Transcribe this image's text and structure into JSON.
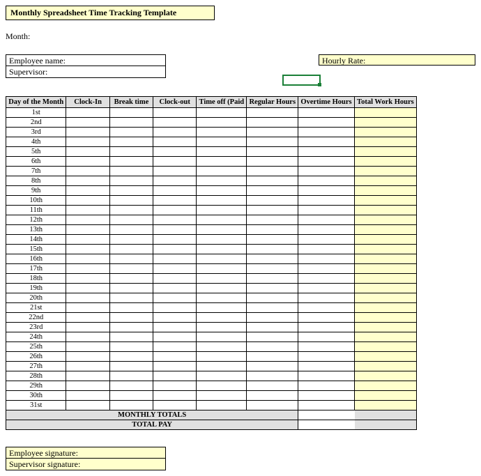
{
  "title": "Monthly Spreadsheet Time Tracking Template",
  "month_label": "Month:",
  "employee_name_label": "Employee name:",
  "supervisor_label": "Supervisor:",
  "hourly_rate_label": "Hourly Rate:",
  "columns": [
    "Day of the Month",
    "Clock-In",
    "Break time",
    "Clock-out",
    "Time off (Paid",
    "Regular Hours",
    "Overtime Hours",
    "Total Work Hours"
  ],
  "days": [
    "1st",
    "2nd",
    "3rd",
    "4th",
    "5th",
    "6th",
    "7th",
    "8th",
    "9th",
    "10th",
    "11th",
    "12th",
    "13th",
    "14th",
    "15th",
    "16th",
    "17th",
    "18th",
    "19th",
    "20th",
    "21st",
    "22nd",
    "23rd",
    "24th",
    "25th",
    "26th",
    "27th",
    "28th",
    "29th",
    "30th",
    "31st"
  ],
  "monthly_totals_label": "MONTHLY TOTALS",
  "total_pay_label": "TOTAL PAY",
  "employee_signature_label": "Employee signature:",
  "supervisor_signature_label": "Supervisor signature:"
}
